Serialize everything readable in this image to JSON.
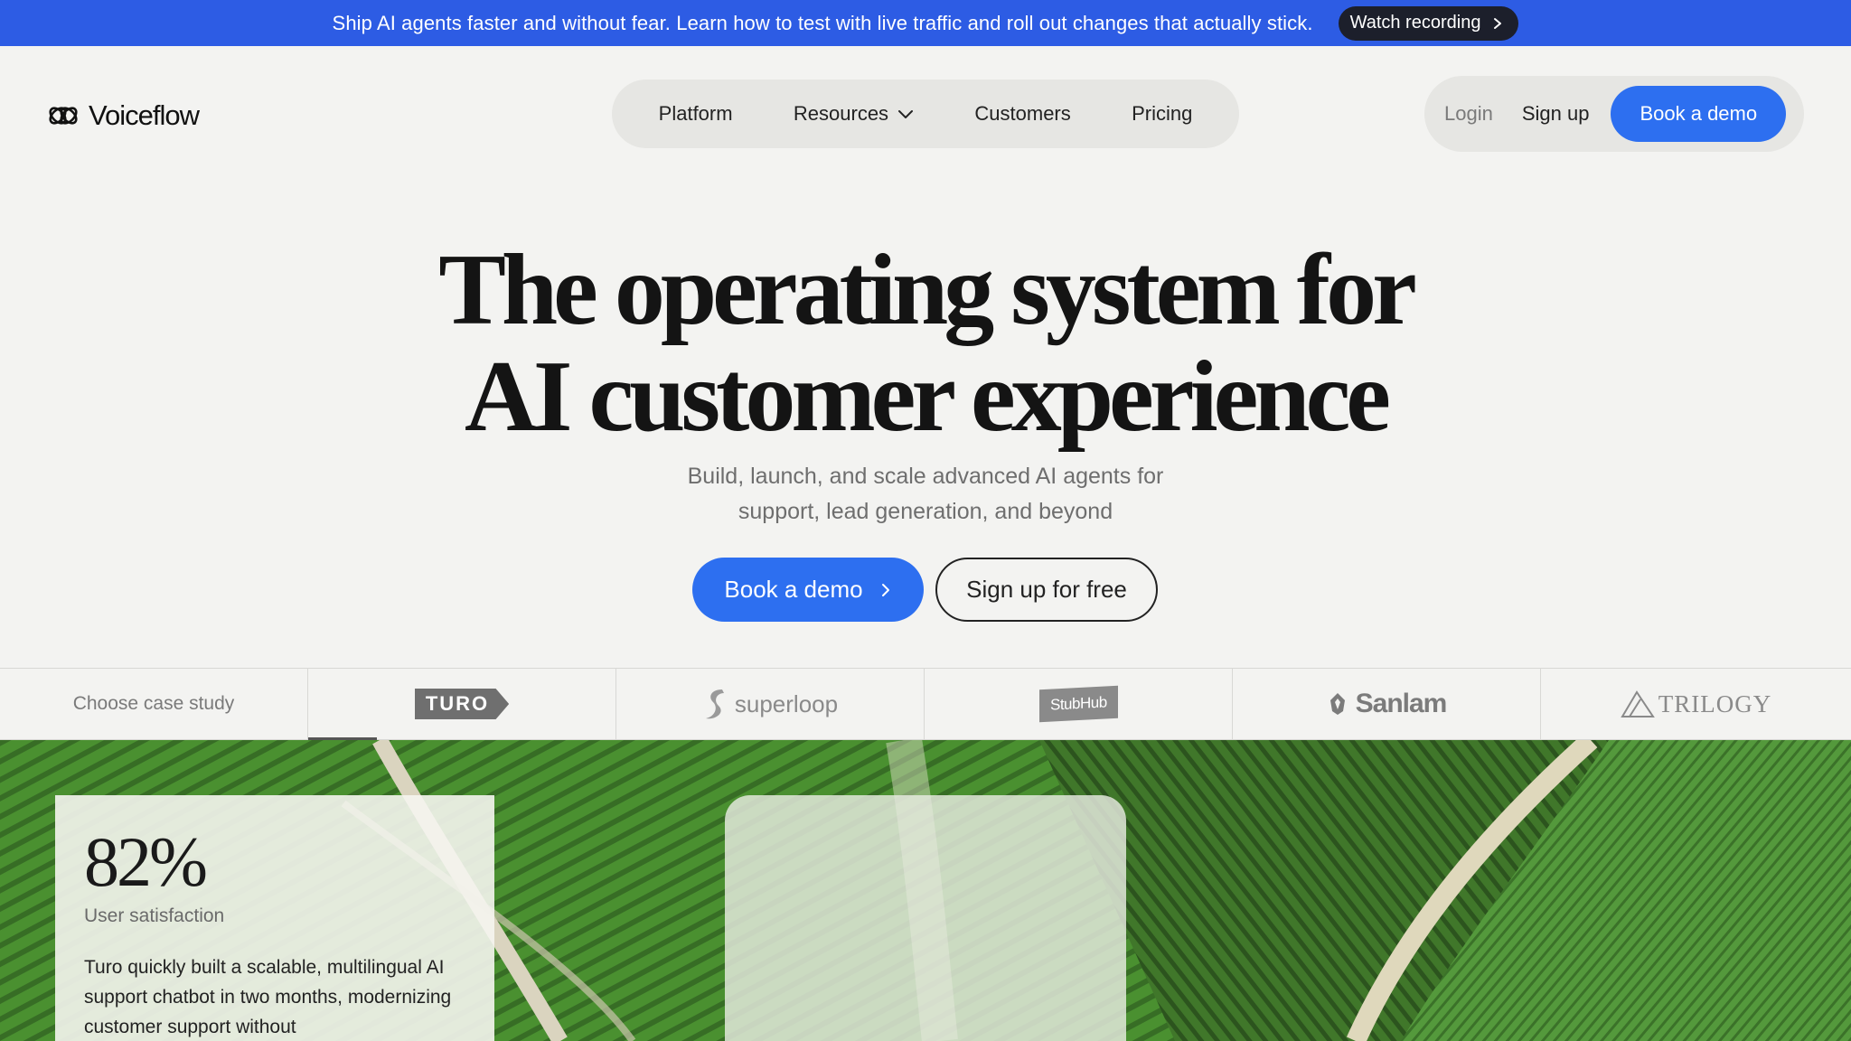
{
  "banner": {
    "text": "Ship AI agents faster and without fear. Learn how to test with live traffic and roll out changes that actually stick.",
    "button_label": "Watch recording"
  },
  "brand": {
    "name": "Voiceflow"
  },
  "nav": {
    "items": [
      {
        "label": "Platform"
      },
      {
        "label": "Resources",
        "dropdown": true
      },
      {
        "label": "Customers"
      },
      {
        "label": "Pricing"
      }
    ]
  },
  "auth": {
    "login": "Login",
    "signup": "Sign up",
    "demo": "Book a demo"
  },
  "hero": {
    "title_line1": "The operating system for",
    "title_line2": "AI customer experience",
    "subtitle_line1": "Build, launch, and scale advanced AI agents for",
    "subtitle_line2": "support, lead generation, and beyond",
    "cta_primary": "Book a demo",
    "cta_secondary": "Sign up for free"
  },
  "cases": {
    "label": "Choose case study",
    "logos": [
      "TURO",
      "superloop",
      "StubHub",
      "Sanlam",
      "TRILOGY"
    ],
    "active": "TURO"
  },
  "case_study": {
    "stat_value": "82%",
    "stat_label": "User satisfaction",
    "description": "Turo quickly built a scalable, multilingual AI support chatbot in two months, modernizing customer support without"
  },
  "colors": {
    "banner": "#2d5ce4",
    "accent": "#2d6ff0",
    "background": "#f3f3f1"
  }
}
